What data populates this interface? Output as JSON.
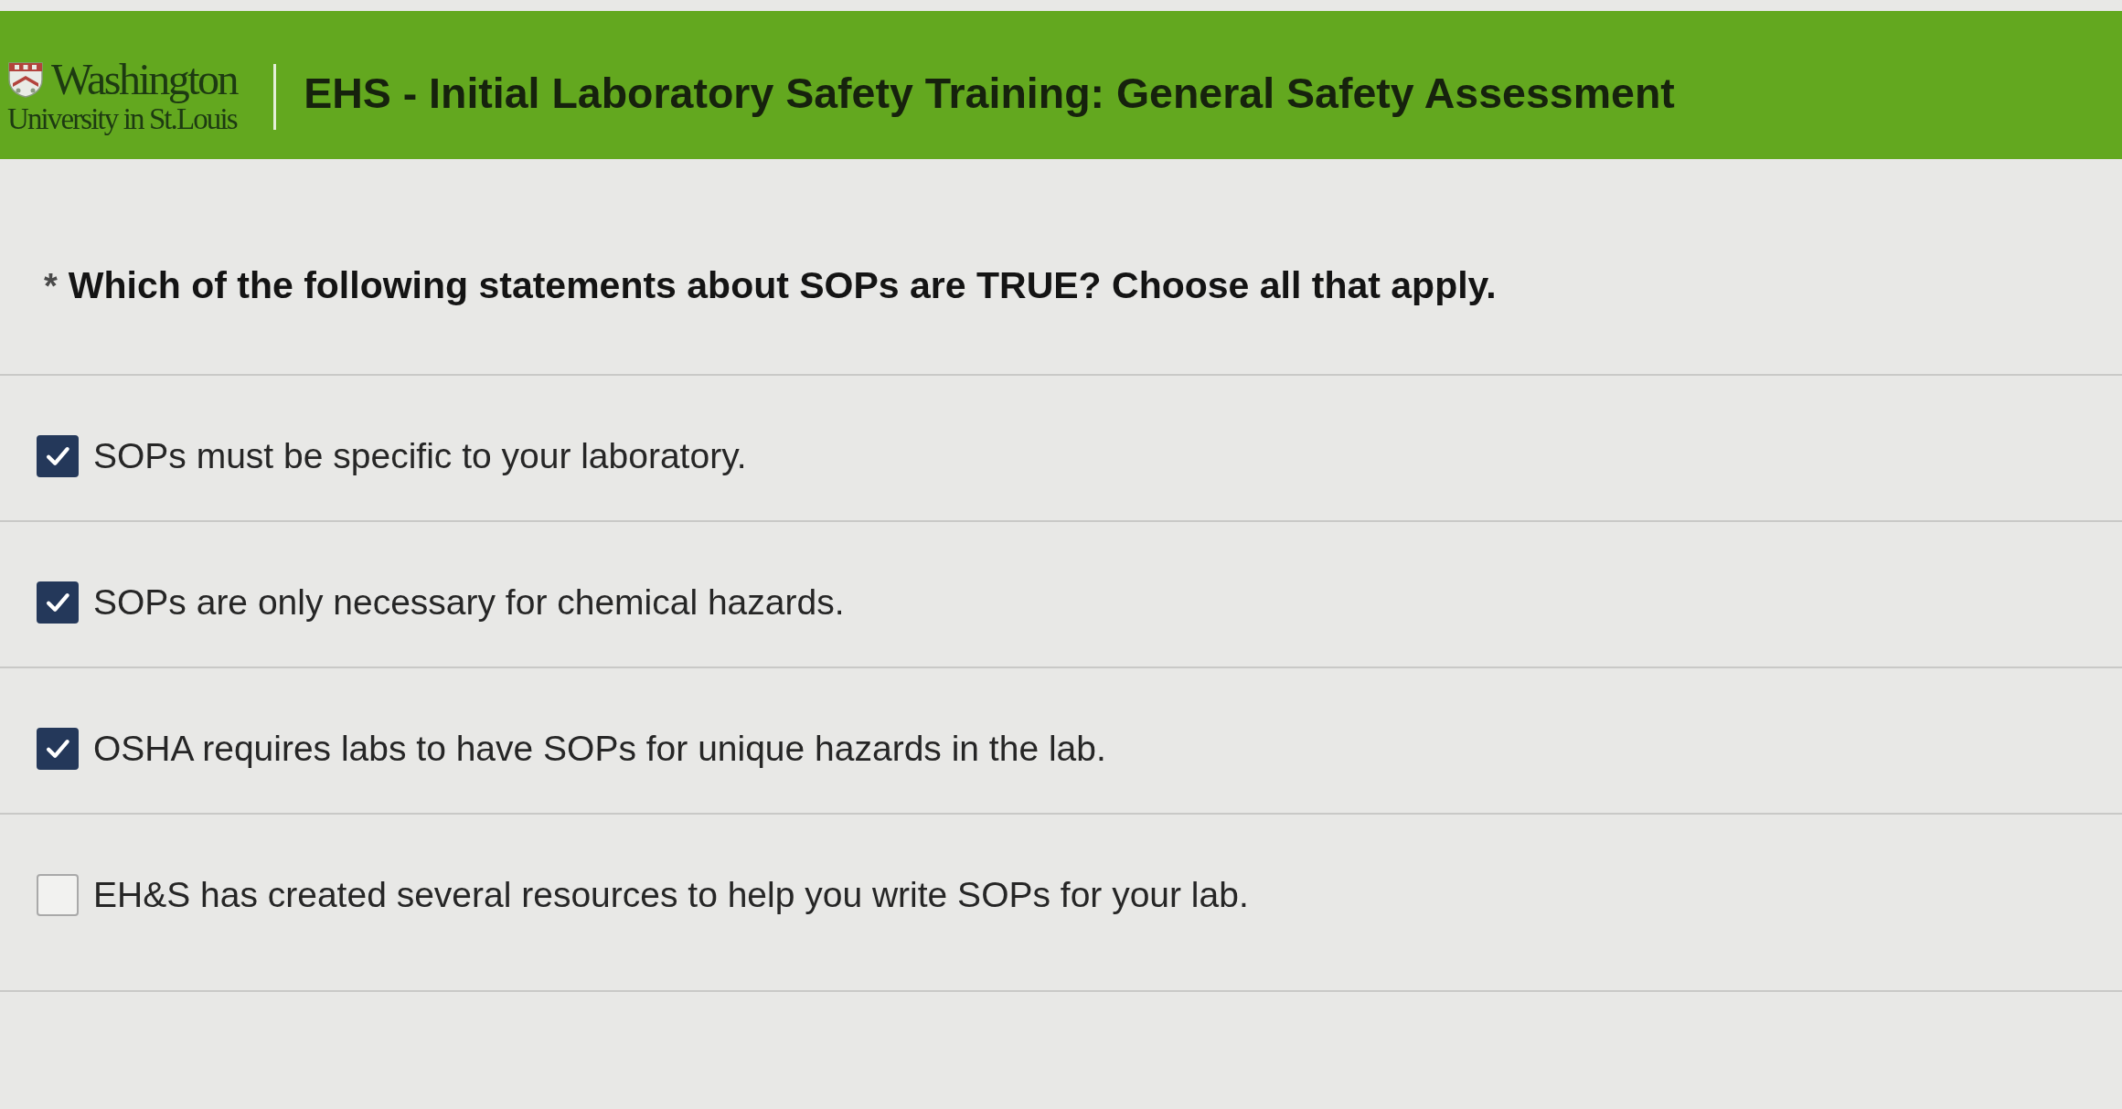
{
  "header": {
    "logo": {
      "line_1": "Washington",
      "line_2": "University in St.Louis"
    },
    "title": "EHS - Initial Laboratory Safety Training: General Safety Assessment"
  },
  "question": {
    "required_mark": "*",
    "text": "Which of the following statements about SOPs are TRUE? Choose all that apply."
  },
  "options": [
    {
      "label": "SOPs must be specific to your laboratory.",
      "checked": true
    },
    {
      "label": "SOPs are only necessary for chemical hazards.",
      "checked": true
    },
    {
      "label": "OSHA requires labs to have SOPs for unique hazards in the lab.",
      "checked": true
    },
    {
      "label": "EH&S has created several resources to help you write SOPs for your lab.",
      "checked": false
    }
  ]
}
